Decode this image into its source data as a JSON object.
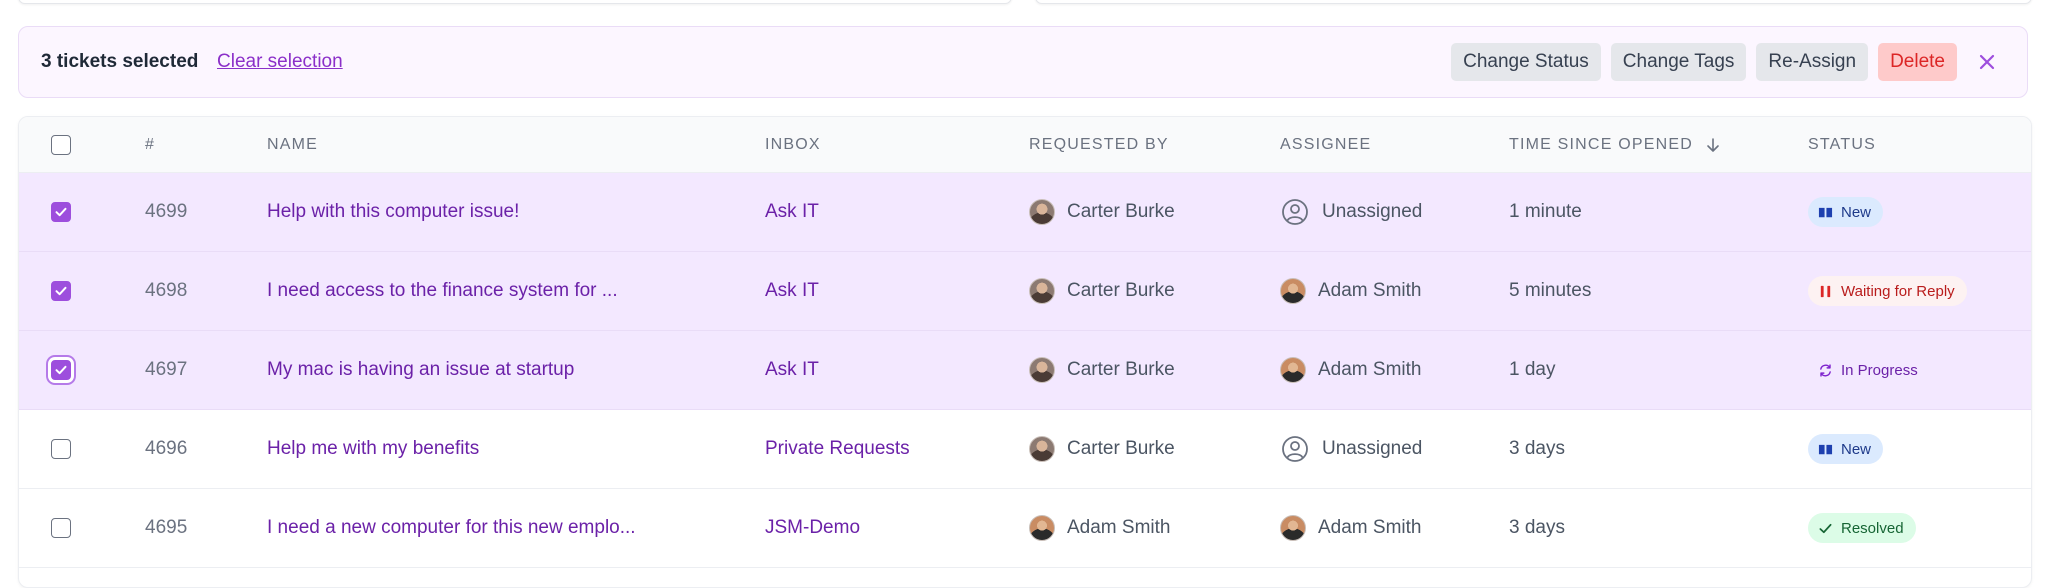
{
  "bulk": {
    "count_text": "3 tickets selected",
    "clear_label": "Clear selection",
    "actions": {
      "change_status": "Change Status",
      "change_tags": "Change Tags",
      "reassign": "Re-Assign",
      "delete": "Delete"
    },
    "close_icon": "close-icon"
  },
  "table": {
    "headers": {
      "num": "#",
      "name": "NAME",
      "inbox": "INBOX",
      "requested_by": "REQUESTED BY",
      "assignee": "ASSIGNEE",
      "time": "TIME SINCE OPENED",
      "status": "STATUS"
    },
    "sort_icon": "arrow-down-icon",
    "rows": [
      {
        "num": "4699",
        "name": "Help with this computer issue!",
        "inbox": "Ask IT",
        "requested_by": "Carter Burke",
        "assignee": "Unassigned",
        "time": "1 minute",
        "status": "New",
        "checked": true
      },
      {
        "num": "4698",
        "name": "I need access to the finance system for ...",
        "inbox": "Ask IT",
        "requested_by": "Carter Burke",
        "assignee": "Adam Smith",
        "time": "5 minutes",
        "status": "Waiting for Reply",
        "checked": true
      },
      {
        "num": "4697",
        "name": "My mac is having an issue at startup",
        "inbox": "Ask IT",
        "requested_by": "Carter Burke",
        "assignee": "Adam Smith",
        "time": "1 day",
        "status": "In Progress",
        "checked": true
      },
      {
        "num": "4696",
        "name": "Help me with my benefits",
        "inbox": "Private Requests",
        "requested_by": "Carter Burke",
        "assignee": "Unassigned",
        "time": "3 days",
        "status": "New",
        "checked": false
      },
      {
        "num": "4695",
        "name": "I need a new computer for this new emplo...",
        "inbox": "JSM-Demo",
        "requested_by": "Adam Smith",
        "assignee": "Adam Smith",
        "time": "3 days",
        "status": "Resolved",
        "checked": false
      }
    ]
  },
  "colors": {
    "accent": "#9d4edd",
    "selected_row": "#f3e8ff",
    "link": "#6b21a8",
    "danger_bg": "#fecaca",
    "danger_text": "#dc2626"
  }
}
